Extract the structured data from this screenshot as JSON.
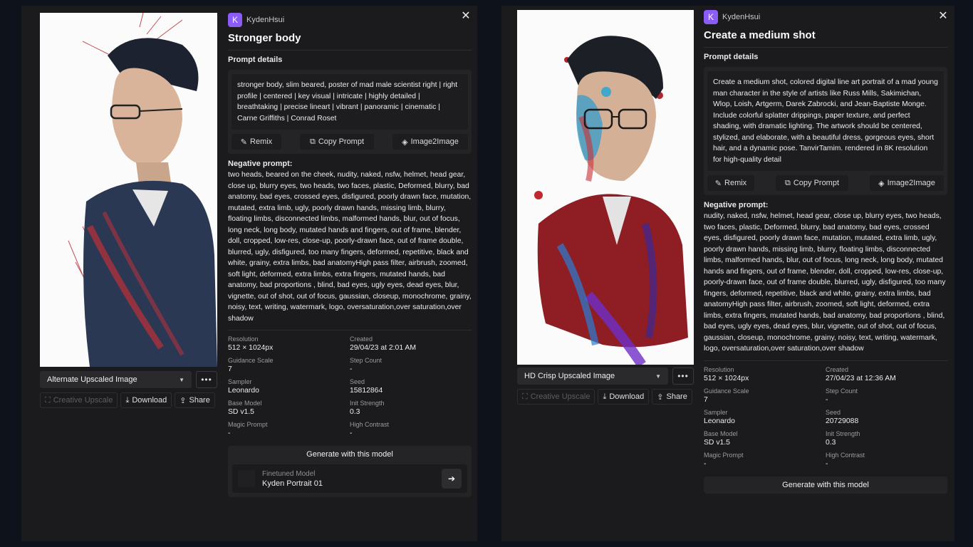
{
  "left": {
    "username": "KydenHsui",
    "avatar_letter": "K",
    "title": "Stronger body",
    "prompt_label": "Prompt details",
    "prompt": "stronger body, slim beared, poster of mad male scientist right | right profile | centered | key visual | intricate | highly detailed | breathtaking | precise lineart | vibrant | panoramic | cinematic | Carne Griffiths | Conrad Roset",
    "remix": "Remix",
    "copy_prompt": "Copy Prompt",
    "image2image": "Image2Image",
    "negative_label": "Negative prompt:",
    "negative": "two heads, beared on the cheek, nudity, naked, nsfw, helmet, head gear, close up, blurry eyes, two heads, two faces, plastic, Deformed, blurry, bad anatomy, bad eyes, crossed eyes, disfigured, poorly drawn face, mutation, mutated, extra limb, ugly, poorly drawn hands, missing limb, blurry, floating limbs, disconnected limbs, malformed hands, blur, out of focus, long neck, long body, mutated hands and fingers, out of frame, blender, doll, cropped, low-res, close-up, poorly-drawn face, out of frame double, blurred, ugly, disfigured, too many fingers, deformed, repetitive, black and white, grainy, extra limbs, bad anatomyHigh pass filter, airbrush, zoomed, soft light, deformed, extra limbs, extra fingers, mutated hands, bad anatomy, bad proportions , blind, bad eyes, ugly eyes, dead eyes, blur, vignette, out of shot, out of focus, gaussian, closeup, monochrome, grainy, noisy, text, writing, watermark, logo, oversaturation,over saturation,over shadow",
    "meta": [
      {
        "k": "Resolution",
        "v": "512 × 1024px"
      },
      {
        "k": "Created",
        "v": "29/04/23 at 2:01 AM"
      },
      {
        "k": "Guidance Scale",
        "v": "7"
      },
      {
        "k": "Step Count",
        "v": "-"
      },
      {
        "k": "Sampler",
        "v": "Leonardo"
      },
      {
        "k": "Seed",
        "v": "15812864"
      },
      {
        "k": "Base Model",
        "v": "SD v1.5"
      },
      {
        "k": "Init Strength",
        "v": "0.3"
      },
      {
        "k": "Magic Prompt",
        "v": "-"
      },
      {
        "k": "High Contrast",
        "v": "-"
      }
    ],
    "upscale_select": "Alternate Upscaled Image",
    "creative_upscale": "Creative Upscale",
    "download": "Download",
    "share": "Share",
    "generate_title": "Generate with this model",
    "model_label": "Finetuned Model",
    "model_name": "Kyden Portrait 01"
  },
  "right": {
    "username": "KydenHsui",
    "avatar_letter": "K",
    "title": "Create a medium shot",
    "prompt_label": "Prompt details",
    "prompt": "Create a medium shot, colored digital line art portrait of a mad young man character in the style of artists like Russ Mills, Sakimichan, Wlop, Loish, Artgerm, Darek Zabrocki, and Jean-Baptiste Monge. Include colorful splatter drippings, paper texture, and perfect shading, with dramatic lighting. The artwork should be centered, stylized, and elaborate, with a beautiful dress, gorgeous eyes, short hair, and a dynamic pose. TanvirTamim. rendered in 8K resolution for high-quality detail",
    "remix": "Remix",
    "copy_prompt": "Copy Prompt",
    "image2image": "Image2Image",
    "negative_label": "Negative prompt:",
    "negative": "nudity, naked, nsfw, helmet, head gear, close up, blurry eyes, two heads, two faces, plastic, Deformed, blurry, bad anatomy, bad eyes, crossed eyes, disfigured, poorly drawn face, mutation, mutated, extra limb, ugly, poorly drawn hands, missing limb, blurry, floating limbs, disconnected limbs, malformed hands, blur, out of focus, long neck, long body, mutated hands and fingers, out of frame, blender, doll, cropped, low-res, close-up, poorly-drawn face, out of frame double, blurred, ugly, disfigured, too many fingers, deformed, repetitive, black and white, grainy, extra limbs, bad anatomyHigh pass filter, airbrush, zoomed, soft light, deformed, extra limbs, extra fingers, mutated hands, bad anatomy, bad proportions , blind, bad eyes, ugly eyes, dead eyes, blur, vignette, out of shot, out of focus, gaussian, closeup, monochrome, grainy, noisy, text, writing, watermark, logo, oversaturation,over saturation,over shadow",
    "meta": [
      {
        "k": "Resolution",
        "v": "512 × 1024px"
      },
      {
        "k": "Created",
        "v": "27/04/23 at 12:36 AM"
      },
      {
        "k": "Guidance Scale",
        "v": "7"
      },
      {
        "k": "Step Count",
        "v": "-"
      },
      {
        "k": "Sampler",
        "v": "Leonardo"
      },
      {
        "k": "Seed",
        "v": "20729088"
      },
      {
        "k": "Base Model",
        "v": "SD v1.5"
      },
      {
        "k": "Init Strength",
        "v": "0.3"
      },
      {
        "k": "Magic Prompt",
        "v": "-"
      },
      {
        "k": "High Contrast",
        "v": "-"
      }
    ],
    "upscale_select": "HD Crisp Upscaled Image",
    "creative_upscale": "Creative Upscale",
    "download": "Download",
    "share": "Share",
    "generate_title": "Generate with this model"
  },
  "icons": {
    "close": "close-icon",
    "more": "more-icon",
    "caret": "chevron-down-icon",
    "remix": "wand-icon",
    "copy": "copy-icon",
    "image2image": "layers-icon",
    "download": "download-icon",
    "share": "share-icon",
    "arrow": "arrow-right-icon"
  },
  "colors": {
    "background": "#0e121a",
    "panel": "#1b1b1d",
    "avatar": "#8b5cf6"
  }
}
